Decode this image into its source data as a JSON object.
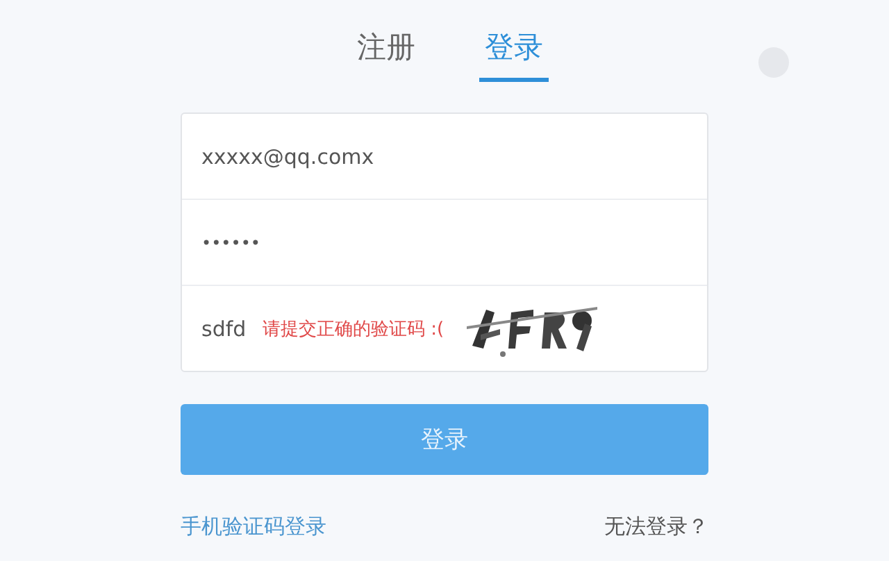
{
  "tabs": [
    {
      "label": "注册",
      "selected": false
    },
    {
      "label": "登录",
      "selected": true
    }
  ],
  "form": {
    "email": {
      "value": "xxxxx@qq.comx"
    },
    "password": {
      "value": "••••••"
    },
    "captcha": {
      "value": "sdfd",
      "error": "请提交正确的验证码 :("
    }
  },
  "submit": "登录",
  "links": [
    {
      "label": "手机验证码登录",
      "kind": "primary"
    },
    {
      "label": "无法登录？",
      "kind": "muted"
    }
  ]
}
